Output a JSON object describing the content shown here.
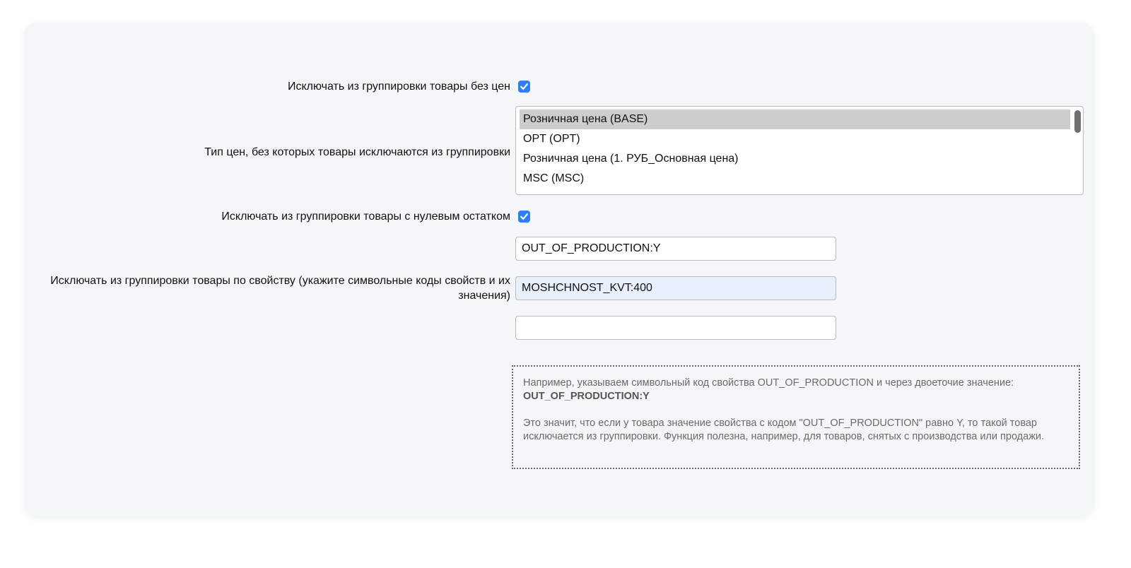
{
  "settings": {
    "exclude_no_price": {
      "label": "Исключать из группировки товары без цен",
      "checked": true
    },
    "price_types": {
      "label": "Тип цен, без которых товары исключаются из группировки",
      "options": [
        "Розничная цена (BASE)",
        "OPT (OPT)",
        "Розничная цена (1. РУБ_Основная цена)",
        "MSC (MSC)"
      ],
      "selected_index": 0
    },
    "exclude_zero_stock": {
      "label": "Исключать из группировки товары с нулевым остатком",
      "checked": true
    },
    "exclude_by_property": {
      "label": "Исключать из группировки товары по свойству (укажите символьные коды свойств и их значения)",
      "values": [
        "OUT_OF_PRODUCTION:Y",
        "MOSHCHNOST_KVT:400",
        ""
      ]
    }
  },
  "hint": {
    "line1": "Например, указываем символьный код свойства OUT_OF_PRODUCTION и через двоеточие значение:",
    "code": "OUT_OF_PRODUCTION:Y",
    "line2": "Это значит, что если у товара значение свойства с кодом \"OUT_OF_PRODUCTION\" равно Y, то такой товар исключается из группировки. Функция полезна, например, для товаров, снятых с производства или продажи."
  },
  "colors": {
    "checkbox_accent": "#2f7ff0",
    "panel_bg": "#f4f7f8",
    "selected_option_bg": "#cdcdcd",
    "autofill_bg": "#e8effd"
  }
}
